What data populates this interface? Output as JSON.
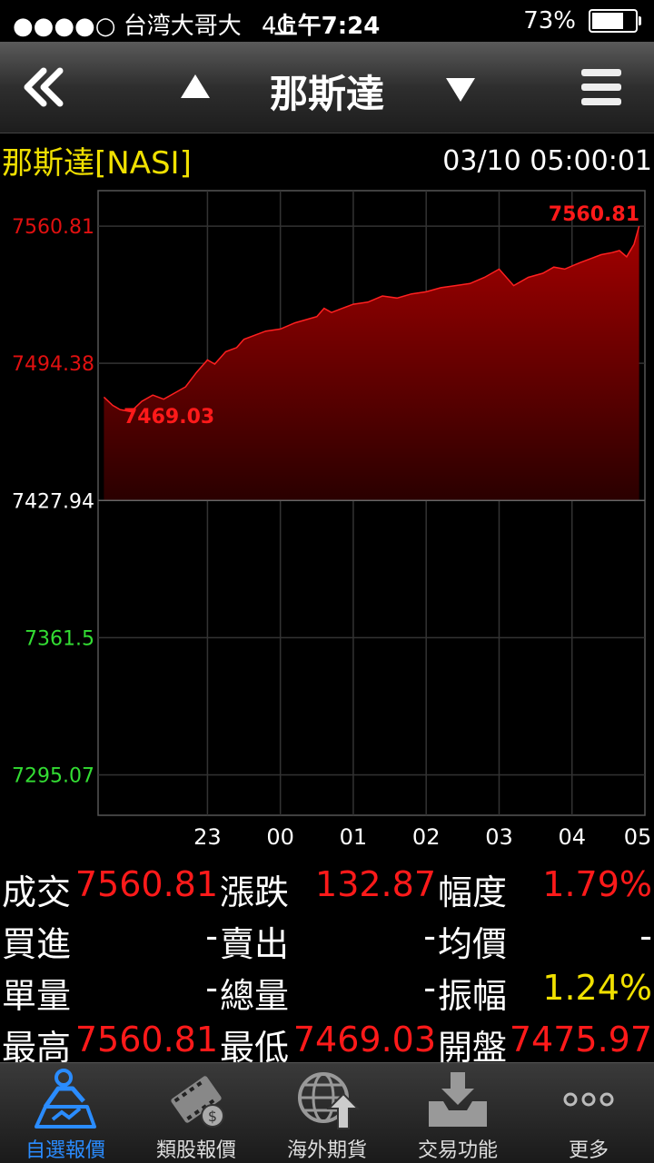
{
  "status": {
    "carrier": "●●●●○ 台湾大哥大",
    "network": "4G",
    "time": "上午7:24",
    "battery": "73%",
    "battery_level": 0.73
  },
  "nav": {
    "title": "那斯達",
    "back_icon": "double-chevron-left-icon",
    "up_icon": "up-triangle-icon",
    "down_icon": "down-triangle-icon",
    "menu_icon": "hamburger-menu-icon"
  },
  "header": {
    "name": "那斯達[NASI]",
    "datetime": "03/10 05:00:01"
  },
  "chart_data": {
    "type": "area",
    "title": "",
    "y_ticks": [
      "7560.81",
      "7494.38",
      "7427.94",
      "7361.5",
      "7295.07"
    ],
    "y_tick_values": [
      7560.81,
      7494.38,
      7427.94,
      7361.5,
      7295.07
    ],
    "y_tick_colors": [
      "#e01010",
      "#e01010",
      "#ffffff",
      "#33dd33",
      "#33dd33"
    ],
    "x_ticks": [
      "23",
      "00",
      "01",
      "02",
      "03",
      "04",
      "05"
    ],
    "x_tick_values": [
      22.5,
      23.5,
      24.5,
      25.5,
      26.5,
      27.5,
      28.4
    ],
    "ylim": [
      7275.5,
      7578.0
    ],
    "xlim": [
      21.0,
      28.5
    ],
    "reference": 7427.94,
    "high_label": "7560.81",
    "low_label": "7469.03",
    "series": [
      {
        "x": [
          21.08,
          21.2,
          21.3,
          21.45,
          21.6,
          21.75,
          21.9,
          22.05,
          22.2,
          22.35,
          22.5,
          22.6,
          22.75,
          22.9,
          23.0,
          23.15,
          23.3,
          23.5,
          23.7,
          23.9,
          24.0,
          24.1,
          24.2,
          24.35,
          24.5,
          24.7,
          24.9,
          25.1,
          25.3,
          25.5,
          25.7,
          25.9,
          26.1,
          26.3,
          26.5,
          26.7,
          26.9,
          27.1,
          27.25,
          27.4,
          27.6,
          27.75,
          27.9,
          28.05,
          28.15,
          28.25,
          28.35,
          28.42
        ],
        "values": [
          7478,
          7474,
          7472,
          7471,
          7476,
          7479,
          7477,
          7480,
          7483,
          7490,
          7496,
          7494,
          7500,
          7502,
          7506,
          7508,
          7510,
          7511,
          7514,
          7516,
          7517,
          7521,
          7519,
          7521,
          7523,
          7524,
          7527,
          7526,
          7528,
          7529,
          7531,
          7532,
          7533,
          7536,
          7540,
          7532,
          7536,
          7538,
          7541,
          7540,
          7543,
          7545,
          7547,
          7548,
          7549,
          7546,
          7552,
          7560.81
        ]
      }
    ]
  },
  "quote": {
    "rows": [
      [
        {
          "label": "成交"
        },
        {
          "value": "7560.81",
          "color": "red"
        },
        {
          "label": "漲跌"
        },
        {
          "value": "132.87",
          "color": "red"
        },
        {
          "label": "幅度"
        },
        {
          "value": "1.79%",
          "color": "red"
        }
      ],
      [
        {
          "label": "買進"
        },
        {
          "value": "-",
          "color": "white"
        },
        {
          "label": "賣出"
        },
        {
          "value": "-",
          "color": "white"
        },
        {
          "label": "均價"
        },
        {
          "value": "-",
          "color": "white"
        }
      ],
      [
        {
          "label": "單量"
        },
        {
          "value": "-",
          "color": "white"
        },
        {
          "label": "總量"
        },
        {
          "value": "-",
          "color": "white"
        },
        {
          "label": "振幅"
        },
        {
          "value": "1.24%",
          "color": "yellow"
        }
      ],
      [
        {
          "label": "最高"
        },
        {
          "value": "7560.81",
          "color": "red"
        },
        {
          "label": "最低"
        },
        {
          "value": "7469.03",
          "color": "red"
        },
        {
          "label": "開盤"
        },
        {
          "value": "7475.97",
          "color": "red"
        }
      ]
    ]
  },
  "tabs": [
    {
      "label": "自選報價",
      "icon": "person-chart-icon",
      "active": true
    },
    {
      "label": "類股報價",
      "icon": "film-coin-icon",
      "active": false
    },
    {
      "label": "海外期貨",
      "icon": "globe-arrow-icon",
      "active": false
    },
    {
      "label": "交易功能",
      "icon": "tray-download-icon",
      "active": false
    },
    {
      "label": "更多",
      "icon": "more-dots-icon",
      "active": false
    }
  ],
  "colors": {
    "accent": "#2a8cff",
    "up": "#ff1a1a",
    "down": "#33dd33",
    "header_text": "#f0e000"
  }
}
